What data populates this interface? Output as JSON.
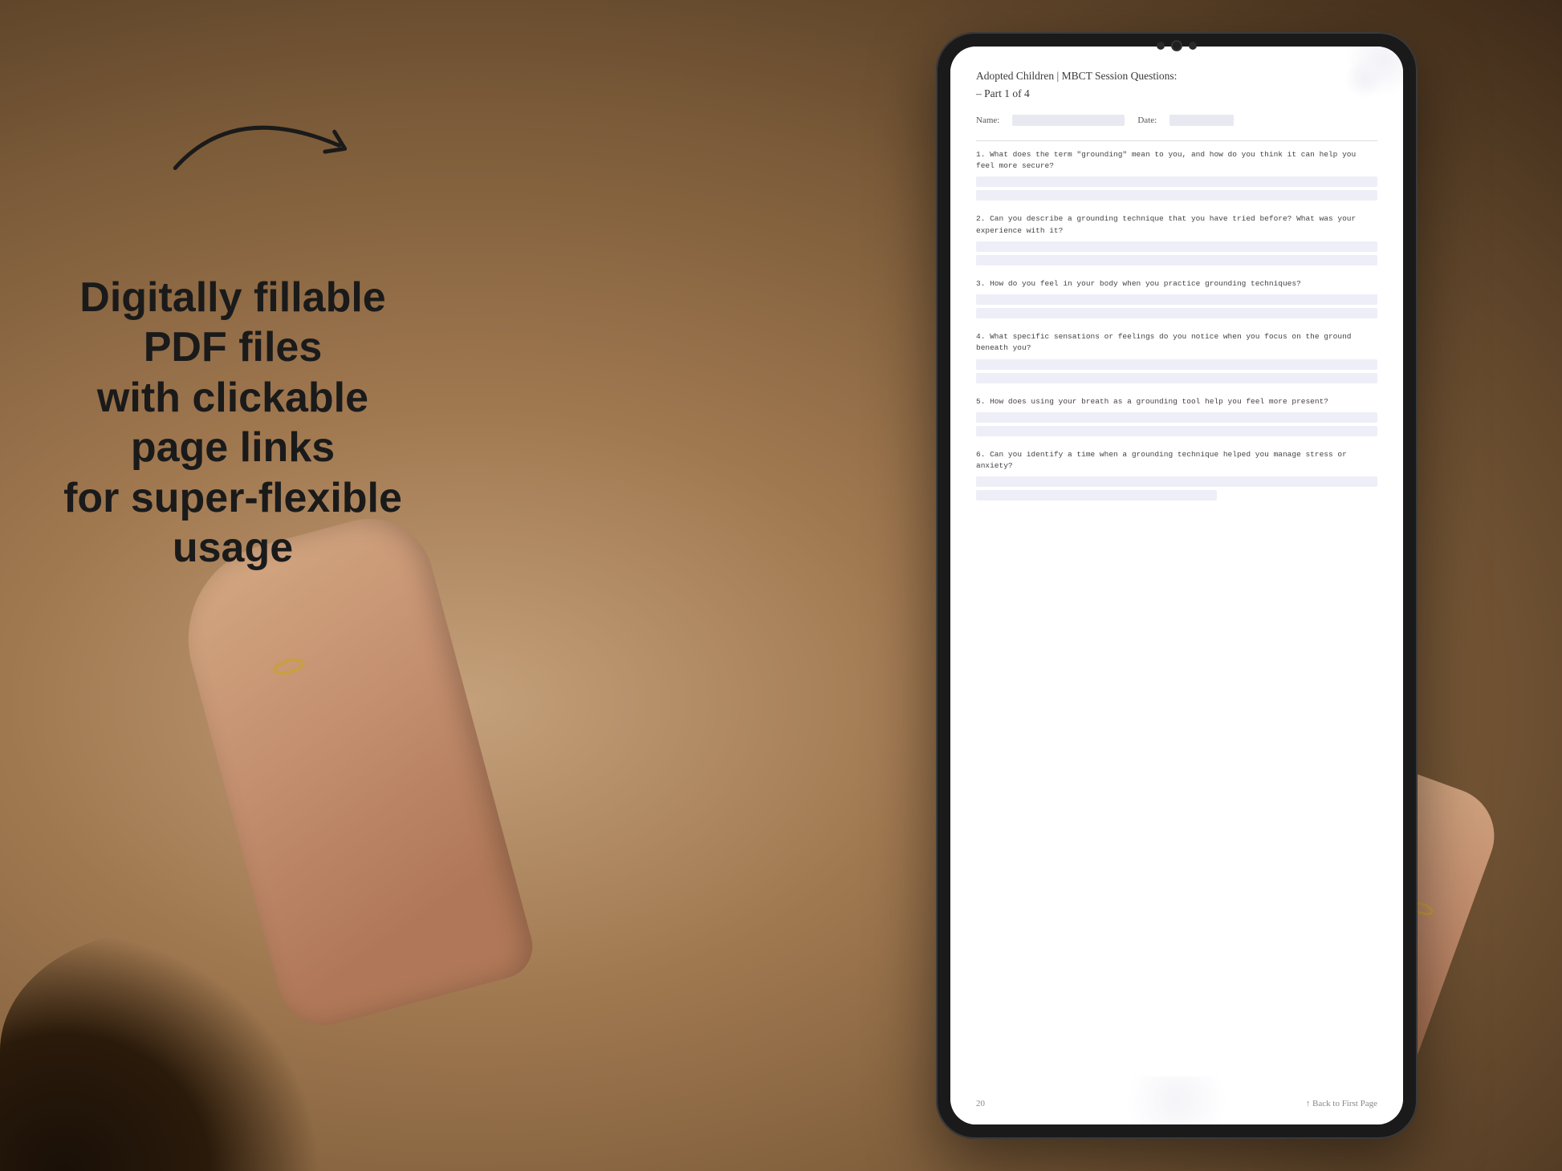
{
  "background": {
    "color": "#b8956a"
  },
  "arrow": {
    "description": "curved arrow pointing right toward tablet"
  },
  "left_text": {
    "line1": "Digitally fillable PDF files",
    "line2": "with clickable page links",
    "line3": "for super-flexible usage"
  },
  "tablet": {
    "pdf_page": {
      "title": "Adopted Children | MBCT Session Questions:",
      "subtitle": "– Part 1 of 4",
      "name_label": "Name:",
      "date_label": "Date:",
      "questions": [
        {
          "number": "1.",
          "text": "What does the term \"grounding\" mean to you, and how do you think it can help you feel more secure?"
        },
        {
          "number": "2.",
          "text": "Can you describe a grounding technique that you have tried before? What was your experience with it?"
        },
        {
          "number": "3.",
          "text": "How do you feel in your body when you practice grounding techniques?"
        },
        {
          "number": "4.",
          "text": "What specific sensations or feelings do you notice when you focus on the ground beneath you?"
        },
        {
          "number": "5.",
          "text": "How does using your breath as a grounding tool help you feel more present?"
        },
        {
          "number": "6.",
          "text": "Can you identify a time when a grounding technique helped you manage stress or anxiety?"
        }
      ],
      "footer": {
        "page_number": "20",
        "back_link": "↑ Back to First Page"
      }
    }
  }
}
